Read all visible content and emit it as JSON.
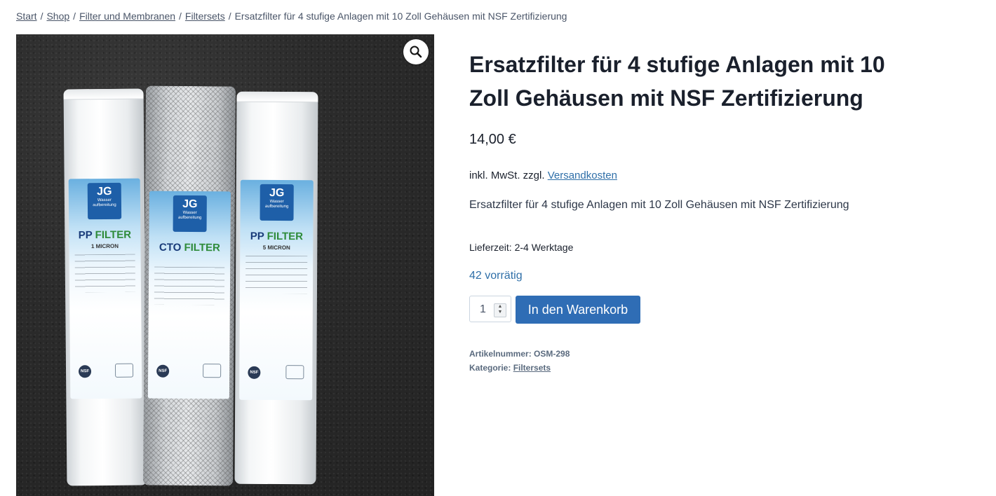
{
  "breadcrumb": {
    "items": [
      "Start",
      "Shop",
      "Filter und Membranen",
      "Filtersets"
    ],
    "current": "Ersatzfilter für 4 stufige Anlagen mit 10 Zoll Gehäusen mit NSF Zertifizierung"
  },
  "product": {
    "title": "Ersatzfilter für 4 stufige Anlagen mit 10 Zoll Gehäusen mit NSF Zertifizierung",
    "price": "14,00 €",
    "tax_prefix": "inkl. MwSt. zzgl.",
    "shipping_link": "Versandkosten",
    "short_description": "Ersatzfilter für 4 stufige Anlagen mit 10 Zoll Gehäusen mit NSF Zertifizierung",
    "delivery": "Lieferzeit: 2-4 Werktage",
    "stock": "42 vorrätig",
    "quantity": "1",
    "add_to_cart": "In den Warenkorb",
    "sku_label": "Artikelnummer:",
    "sku": "OSM-298",
    "category_label": "Kategorie:",
    "category": "Filtersets"
  },
  "gallery": {
    "zoom_icon": "magnifier-icon",
    "filters": [
      {
        "logo": "JG",
        "logo_sub": "Wasser aufbereitung",
        "name_a": "PP",
        "name_b": "FILTER",
        "sub": "1 MICRON"
      },
      {
        "logo": "JG",
        "logo_sub": "Wasser aufbereitung",
        "name_a": "CTO",
        "name_b": "FILTER",
        "sub": ""
      },
      {
        "logo": "JG",
        "logo_sub": "Wasser aufbereitung",
        "name_a": "PP",
        "name_b": "FILTER",
        "sub": "5 MICRON"
      }
    ]
  },
  "colors": {
    "accent": "#2f6db5",
    "link": "#2f6fa8",
    "title": "#1a202c"
  }
}
